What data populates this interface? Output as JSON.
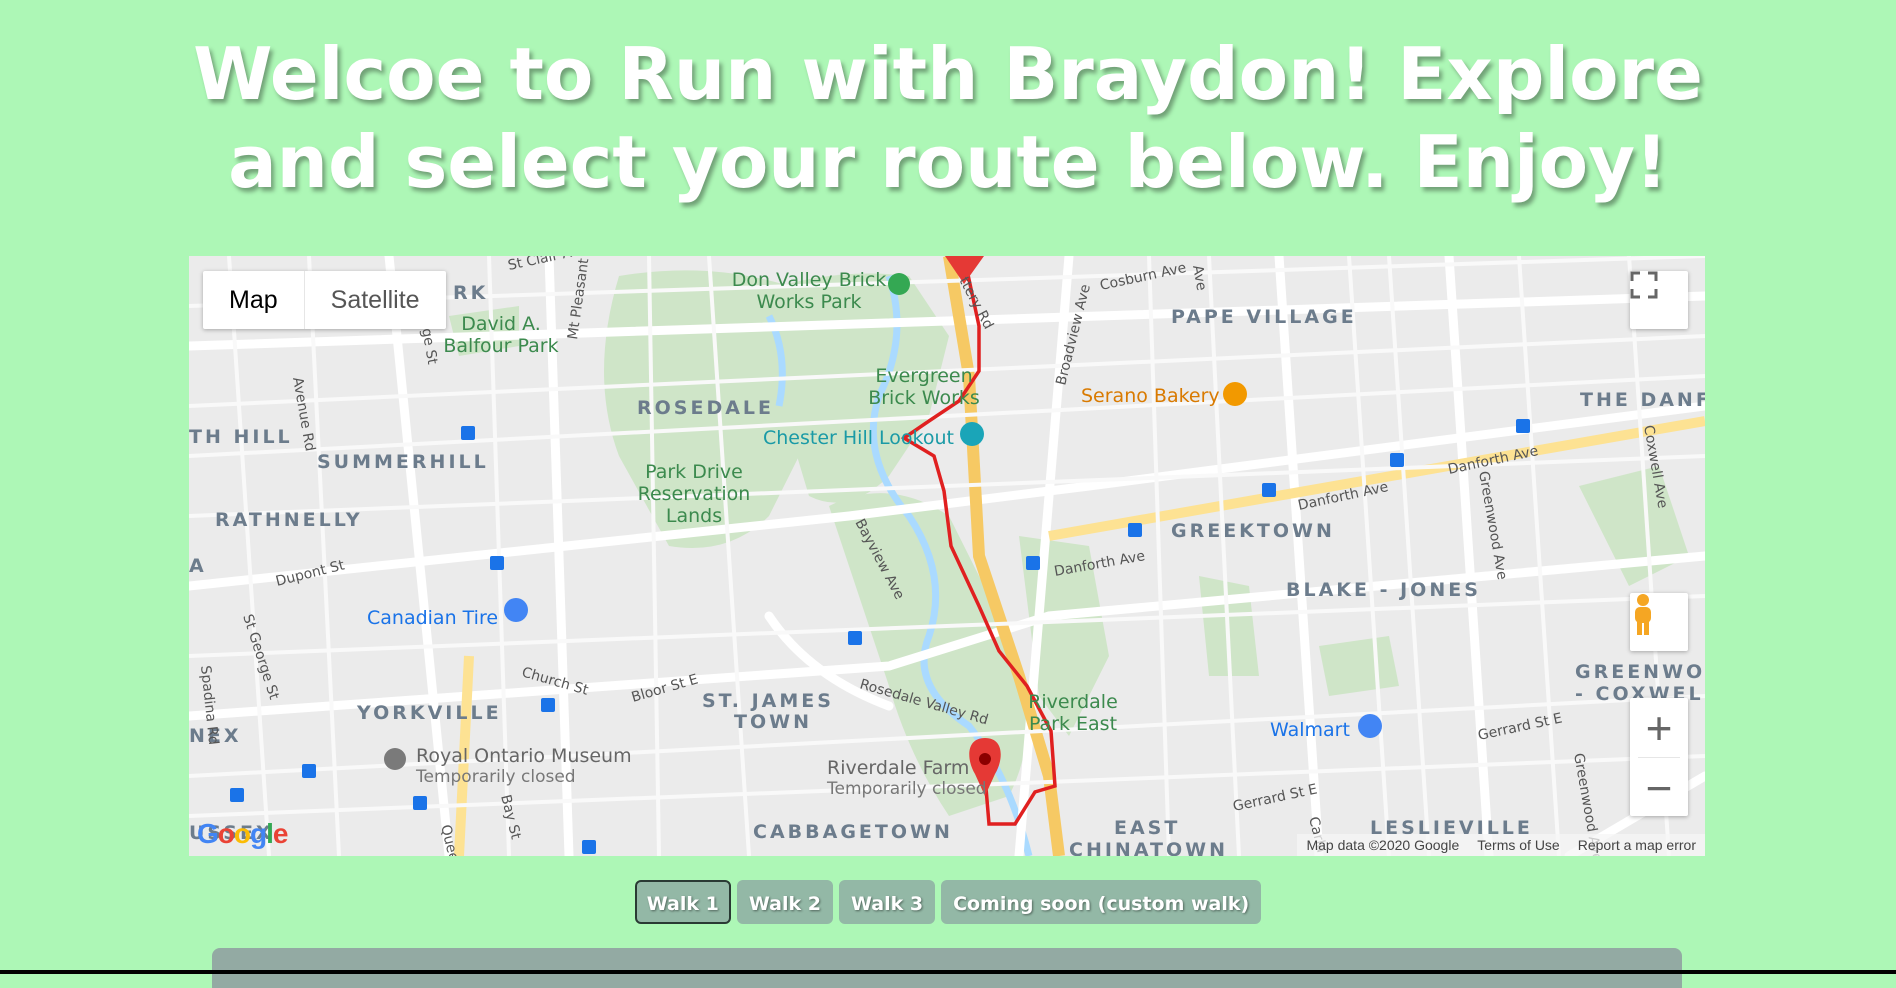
{
  "page": {
    "title_line1": "Welcoe to Run with Braydon! Explore",
    "title_line2": "and select your route below. Enjoy!"
  },
  "map": {
    "type_buttons": [
      "Map",
      "Satellite"
    ],
    "selected_type": "Map",
    "controls": {
      "fullscreen_icon": "fullscreen-icon",
      "pegman_icon": "pegman-icon",
      "zoom_in": "+",
      "zoom_out": "−"
    },
    "attribution": {
      "data": "Map data ©2020 Google",
      "terms": "Terms of Use",
      "report": "Report a map error"
    },
    "google_logo": "Google",
    "labels": {
      "neighbourhoods": [
        "PAPE VILLAGE",
        "ROSEDALE",
        "SUMMERHILL",
        "RATHNELLY",
        "GREEKTOWN",
        "BLAKE - JONES",
        "YORKVILLE",
        "ST. JAMES",
        "TOWN",
        "CABBAGETOWN",
        "EAST",
        "CHINATOWN",
        "LESLIEVILLE",
        "THE DANF",
        "TH HILL",
        "NEX",
        "USSEX",
        "GREENWOO",
        "- COXWEL",
        "RK",
        "A"
      ],
      "places": {
        "don_valley": "Don Valley Brick",
        "don_valley2": "Works Park",
        "balfour": "David A.",
        "balfour2": "Balfour Park",
        "evergreen": "Evergreen",
        "evergreen2": "Brick Works",
        "serano": "Serano Bakery",
        "chester": "Chester Hill Lookout",
        "parkdrive": "Park Drive",
        "parkdrive2": "Reservation",
        "parkdrive3": "Lands",
        "canadiantire": "Canadian Tire",
        "walmart": "Walmart",
        "riverdalepark": "Riverdale",
        "riverdalepark2": "Park East",
        "rom": "Royal Ontario Museum",
        "rom2": "Temporarily closed",
        "farm": "Riverdale Farm",
        "farm2": "Temporarily closed"
      },
      "streets": {
        "stclair": "St Clair A",
        "cosburn": "Cosburn Ave",
        "pottery": "ttery Rd",
        "broadview": "Broadview Ave",
        "mtpleasant": "Mt Pleasant R",
        "yonge": "onge St",
        "avenue": "Avenue Rd",
        "bayview": "Bayview Ave",
        "danforth1": "Danforth Ave",
        "danforth2": "Danforth Ave",
        "danforth3": "Danforth Ave",
        "dupont": "Dupont St",
        "stgeorge": "St George St",
        "church": "Church St",
        "bloor": "Bloor St E",
        "rosedalevalley": "Rosedale Valley Rd",
        "gerrard1": "Gerrard St E",
        "gerrard2": "Gerrard St E",
        "greenwood": "Greenwood Ave",
        "greenwood2": "Greenwood Ave",
        "coxwell": "Coxwell Ave",
        "bay": "Bay St",
        "spadina": "Spadina Rd",
        "carlaw": "Carla",
        "queens": "Quee",
        "ave": "Ave"
      }
    },
    "route_color": "#e02020"
  },
  "walks": {
    "buttons": [
      "Walk 1",
      "Walk 2",
      "Walk 3",
      "Coming soon (custom walk)"
    ],
    "active": "Walk 1"
  },
  "colors": {
    "background": "#adf7b6",
    "button": "#93b8a6"
  }
}
